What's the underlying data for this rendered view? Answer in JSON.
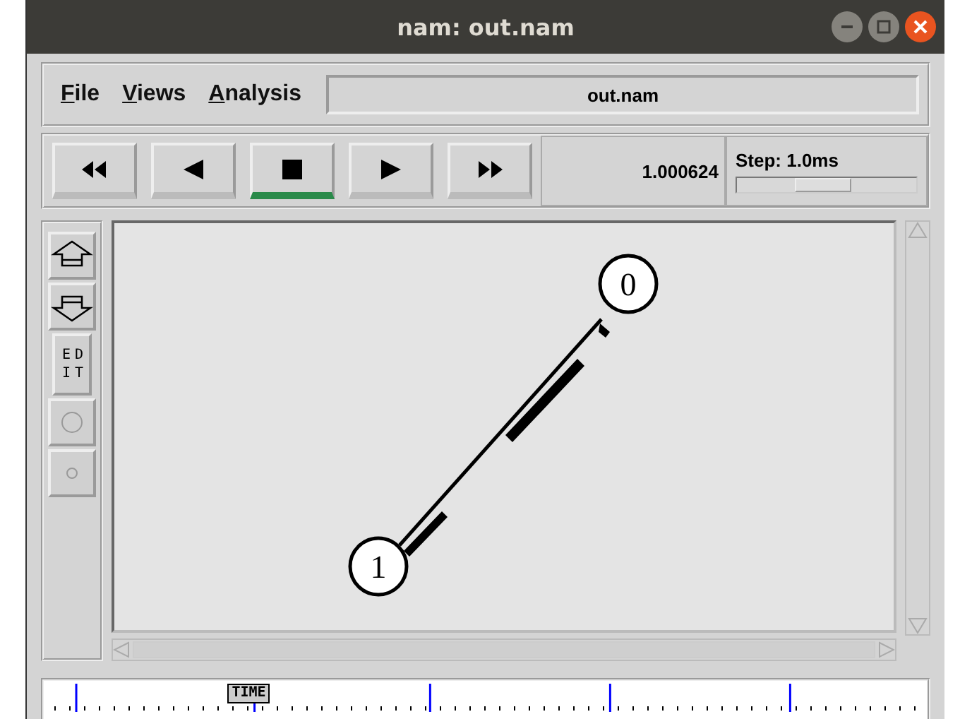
{
  "window": {
    "title": "nam: out.nam"
  },
  "menu": [
    {
      "label": "File"
    },
    {
      "label": "Views"
    },
    {
      "label": "Analysis"
    }
  ],
  "file_name": "out.nam",
  "playback": [
    {
      "kind": "rewind",
      "selected": false
    },
    {
      "kind": "back",
      "selected": false
    },
    {
      "kind": "stop",
      "selected": true
    },
    {
      "kind": "play",
      "selected": false
    },
    {
      "kind": "forward",
      "selected": false
    }
  ],
  "time": "1.000624",
  "step": {
    "label": "Step: 1.0ms",
    "level": 0.48
  },
  "tools": [
    {
      "kind": "zoom-in"
    },
    {
      "kind": "zoom-out"
    },
    {
      "kind": "edit",
      "label": "EDIT"
    },
    {
      "kind": "big-node"
    },
    {
      "kind": "small-node"
    }
  ],
  "nodes": [
    {
      "label": "0"
    },
    {
      "label": "1"
    }
  ],
  "timeline": {
    "marker": "TIME",
    "level": 0.24
  }
}
